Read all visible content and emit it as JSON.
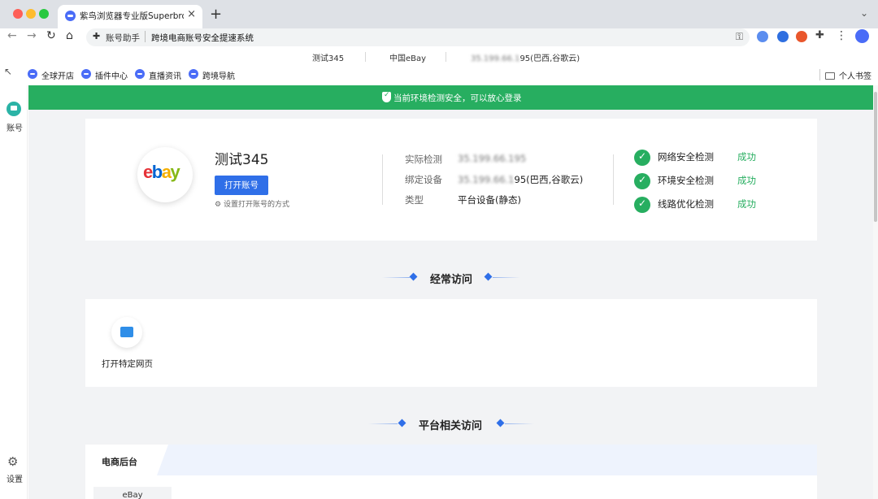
{
  "browser": {
    "tab_title": "紫鸟浏览器专业版Superbrower",
    "tab_close": "×",
    "new_tab": "+",
    "omnibox_label": "账号助手",
    "omnibox_url": "跨境电商账号安全提速系统"
  },
  "info_bar": {
    "account": "测试345",
    "site": "中国eBay",
    "ip_prefix": "35.199.66.1",
    "ip_suffix": "95(巴西,谷歌云)"
  },
  "bookmarks": {
    "items": [
      "全球开店",
      "插件中心",
      "直播资讯",
      "跨境导航"
    ],
    "folder": "个人书签"
  },
  "rail": {
    "account_label": "账号",
    "settings_label": "设置"
  },
  "banner": {
    "text": "当前环境检测安全，可以放心登录"
  },
  "account_card": {
    "logo_letters": [
      "e",
      "b",
      "a",
      "y"
    ],
    "name": "测试345",
    "open_button": "打开账号",
    "open_setting": "设置打开账号的方式",
    "details": [
      {
        "key": "实际检测",
        "value_blurred": "35.199.66.195",
        "value": ""
      },
      {
        "key": "绑定设备",
        "value_blurred": "35.199.66.1",
        "value": "95(巴西,谷歌云)"
      },
      {
        "key": "类型",
        "value_blurred": "",
        "value": "平台设备(静态)"
      }
    ],
    "checks": [
      {
        "label": "网络安全检测",
        "status": "成功"
      },
      {
        "label": "环境安全检测",
        "status": "成功"
      },
      {
        "label": "线路优化检测",
        "status": "成功"
      }
    ]
  },
  "sections": {
    "frequent": "经常访问",
    "platform": "平台相关访问"
  },
  "frequent": {
    "items": [
      {
        "label": "打开特定网页"
      }
    ]
  },
  "platform": {
    "tab": "电商后台",
    "chip": "eBay"
  },
  "colors": {
    "banner_green": "#27ae60",
    "primary_blue": "#2f6fe8",
    "success_green": "#27ae60"
  }
}
